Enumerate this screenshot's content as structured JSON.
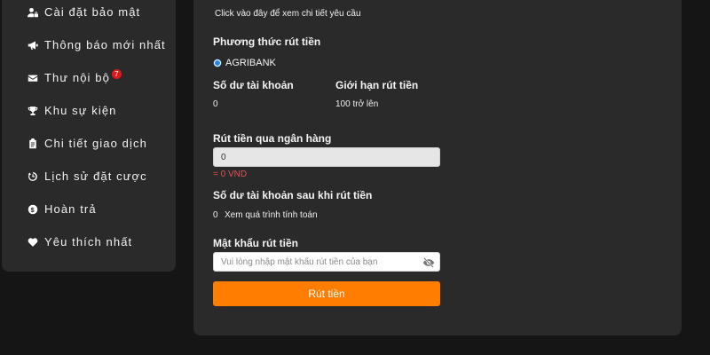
{
  "sidebar": {
    "items": [
      {
        "label": "Cài đặt bảo mật",
        "icon": "user-lock-icon"
      },
      {
        "label": "Thông báo mới nhất",
        "icon": "megaphone-icon"
      },
      {
        "label": "Thư nội bộ",
        "icon": "envelope-icon",
        "badge": "7"
      },
      {
        "label": "Khu sự kiện",
        "icon": "trophy-icon"
      },
      {
        "label": "Chi tiết giao dịch",
        "icon": "clipboard-icon"
      },
      {
        "label": "Lịch sử đặt cược",
        "icon": "history-icon"
      },
      {
        "label": "Hoàn trả",
        "icon": "dollar-circle-icon"
      },
      {
        "label": "Yêu thích nhất",
        "icon": "heart-icon"
      }
    ]
  },
  "main": {
    "detail_link": "Click vào đây để xem chi tiết yêu cầu",
    "method_label": "Phương thức rút tiền",
    "method_option": "AGRIBANK",
    "balance_label": "Số dư tài khoản",
    "balance_value": "0",
    "limit_label": "Giới hạn rút tiền",
    "limit_value": "100 trở lên",
    "amount_label": "Rút tiền qua ngân hàng",
    "amount_value": "0",
    "amount_converted": "= 0 VND",
    "after_label": "Số dư tài khoản sau khi rút tiền",
    "after_value": "0",
    "after_link": "Xem quá trình tính toán",
    "password_label": "Mật khẩu rút tiền",
    "password_placeholder": "Vui lòng nhập mật khẩu rút tiền của bạn",
    "submit_label": "Rút tiền"
  },
  "colors": {
    "background": "#151515",
    "panel": "#2a2a2a",
    "accent": "#ff7d00",
    "badge": "#e0191d",
    "error_text": "#e05555",
    "radio": "#2a7fe0"
  }
}
